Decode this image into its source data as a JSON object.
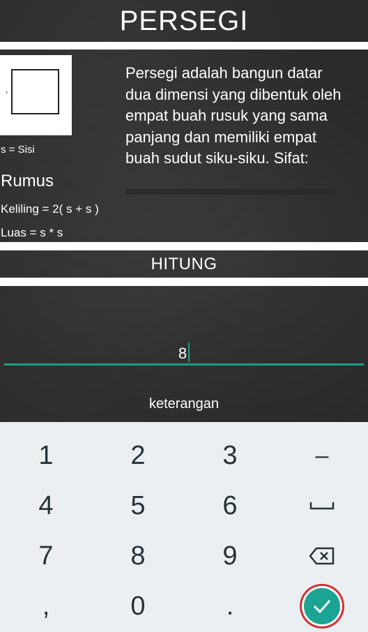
{
  "header": {
    "title": "PERSEGI"
  },
  "shape": {
    "side_label": "s"
  },
  "legend": "s = Sisi",
  "formula": {
    "heading": "Rumus",
    "keliling": "Keliling = 2( s + s )",
    "luas": "Luas = s * s"
  },
  "description": "Persegi adalah bangun datar dua dimensi yang dibentuk oleh empat buah rusuk yang sama panjang dan memiliki empat buah sudut siku-siku. Sifat:",
  "hitung_button": "HITUNG",
  "input": {
    "value": "8"
  },
  "keterangan": "keterangan",
  "keypad": {
    "k1": "1",
    "k2": "2",
    "k3": "3",
    "minus": "–",
    "k4": "4",
    "k5": "5",
    "k6": "6",
    "k7": "7",
    "k8": "8",
    "k9": "9",
    "comma": ",",
    "k0": "0",
    "period": "."
  },
  "colors": {
    "accent": "#1f9c8c",
    "check_button": "#1ba493",
    "highlight_ring": "#d32f2f"
  }
}
